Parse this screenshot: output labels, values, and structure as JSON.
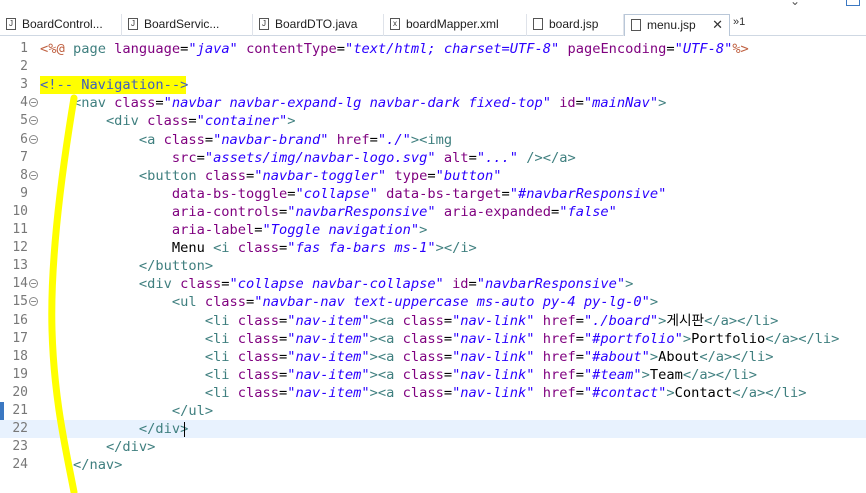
{
  "tabs": [
    {
      "label": "BoardControl...",
      "icon": "java-file-icon",
      "icon_char": "J",
      "active": false
    },
    {
      "label": "BoardServic...",
      "icon": "java-file-icon",
      "icon_char": "J",
      "active": false
    },
    {
      "label": "BoardDTO.java",
      "icon": "java-file-icon",
      "icon_char": "J",
      "active": false
    },
    {
      "label": "boardMapper.xml",
      "icon": "xml-file-icon",
      "icon_char": "x",
      "active": false
    },
    {
      "label": "board.jsp",
      "icon": "jsp-file-icon",
      "icon_char": "",
      "active": false
    },
    {
      "label": "menu.jsp",
      "icon": "jsp-file-icon",
      "icon_char": "",
      "active": true
    }
  ],
  "tab_close": "✕",
  "tab_overflow": "»1",
  "cursor_line": 22,
  "highlight_color": "#ffff00",
  "lines": [
    {
      "n": "1",
      "fold": false,
      "parts": [
        [
          "dir",
          "<%@ "
        ],
        [
          "kw",
          "page "
        ],
        [
          "attr",
          "language"
        ],
        [
          "",
          "="
        ],
        [
          "val",
          "\"java\""
        ],
        [
          "",
          " "
        ],
        [
          "attr",
          "contentType"
        ],
        [
          "",
          "="
        ],
        [
          "val",
          "\"text/html; charset=UTF-8\""
        ],
        [
          "",
          " "
        ],
        [
          "attr",
          "pageEncoding"
        ],
        [
          "",
          "="
        ],
        [
          "val",
          "\"UTF-8\""
        ],
        [
          "dir",
          "%>"
        ]
      ]
    },
    {
      "n": "2",
      "fold": false,
      "parts": []
    },
    {
      "n": "3",
      "fold": false,
      "parts": [
        [
          "cmt",
          "<!-- Navigation-->"
        ]
      ]
    },
    {
      "n": "4",
      "fold": true,
      "parts": [
        [
          "",
          "    "
        ],
        [
          "tag",
          "<nav "
        ],
        [
          "attr",
          "class"
        ],
        [
          "",
          "="
        ],
        [
          "val",
          "\"navbar navbar-expand-lg navbar-dark fixed-top\""
        ],
        [
          "",
          " "
        ],
        [
          "attr",
          "id"
        ],
        [
          "",
          "="
        ],
        [
          "val",
          "\"mainNav\""
        ],
        [
          "tag",
          ">"
        ]
      ]
    },
    {
      "n": "5",
      "fold": true,
      "parts": [
        [
          "",
          "        "
        ],
        [
          "tag",
          "<div "
        ],
        [
          "attr",
          "class"
        ],
        [
          "",
          "="
        ],
        [
          "val",
          "\"container\""
        ],
        [
          "tag",
          ">"
        ]
      ]
    },
    {
      "n": "6",
      "fold": true,
      "parts": [
        [
          "",
          "            "
        ],
        [
          "tag",
          "<a "
        ],
        [
          "attr",
          "class"
        ],
        [
          "",
          "="
        ],
        [
          "val",
          "\"navbar-brand\""
        ],
        [
          "",
          " "
        ],
        [
          "attr",
          "href"
        ],
        [
          "",
          "="
        ],
        [
          "val",
          "\"./\""
        ],
        [
          "tag",
          "><img"
        ]
      ]
    },
    {
      "n": "7",
      "fold": false,
      "parts": [
        [
          "",
          "                "
        ],
        [
          "attr",
          "src"
        ],
        [
          "",
          "="
        ],
        [
          "val",
          "\"assets/img/navbar-logo.svg\""
        ],
        [
          "",
          " "
        ],
        [
          "attr",
          "alt"
        ],
        [
          "",
          "="
        ],
        [
          "val",
          "\"...\""
        ],
        [
          "",
          " "
        ],
        [
          "tag",
          "/></a>"
        ]
      ]
    },
    {
      "n": "8",
      "fold": true,
      "parts": [
        [
          "",
          "            "
        ],
        [
          "tag",
          "<button "
        ],
        [
          "attr",
          "class"
        ],
        [
          "",
          "="
        ],
        [
          "val",
          "\"navbar-toggler\""
        ],
        [
          "",
          " "
        ],
        [
          "attr",
          "type"
        ],
        [
          "",
          "="
        ],
        [
          "val",
          "\"button\""
        ]
      ]
    },
    {
      "n": "9",
      "fold": false,
      "parts": [
        [
          "",
          "                "
        ],
        [
          "attr",
          "data-bs-toggle"
        ],
        [
          "",
          "="
        ],
        [
          "val",
          "\"collapse\""
        ],
        [
          "",
          " "
        ],
        [
          "attr",
          "data-bs-target"
        ],
        [
          "",
          "="
        ],
        [
          "val",
          "\"#navbarResponsive\""
        ]
      ]
    },
    {
      "n": "10",
      "fold": false,
      "parts": [
        [
          "",
          "                "
        ],
        [
          "attr",
          "aria-controls"
        ],
        [
          "",
          "="
        ],
        [
          "val",
          "\"navbarResponsive\""
        ],
        [
          "",
          " "
        ],
        [
          "attr",
          "aria-expanded"
        ],
        [
          "",
          "="
        ],
        [
          "val",
          "\"false\""
        ]
      ]
    },
    {
      "n": "11",
      "fold": false,
      "parts": [
        [
          "",
          "                "
        ],
        [
          "attr",
          "aria-label"
        ],
        [
          "",
          "="
        ],
        [
          "val",
          "\"Toggle navigation\""
        ],
        [
          "tag",
          ">"
        ]
      ]
    },
    {
      "n": "12",
      "fold": false,
      "parts": [
        [
          "",
          "                Menu "
        ],
        [
          "tag",
          "<i "
        ],
        [
          "attr",
          "class"
        ],
        [
          "",
          "="
        ],
        [
          "val",
          "\"fas fa-bars ms-1\""
        ],
        [
          "tag",
          "></i>"
        ]
      ]
    },
    {
      "n": "13",
      "fold": false,
      "parts": [
        [
          "",
          "            "
        ],
        [
          "tag",
          "</button>"
        ]
      ]
    },
    {
      "n": "14",
      "fold": true,
      "parts": [
        [
          "",
          "            "
        ],
        [
          "tag",
          "<div "
        ],
        [
          "attr",
          "class"
        ],
        [
          "",
          "="
        ],
        [
          "val",
          "\"collapse navbar-collapse\""
        ],
        [
          "",
          " "
        ],
        [
          "attr",
          "id"
        ],
        [
          "",
          "="
        ],
        [
          "val",
          "\"navbarResponsive\""
        ],
        [
          "tag",
          ">"
        ]
      ]
    },
    {
      "n": "15",
      "fold": true,
      "parts": [
        [
          "",
          "                "
        ],
        [
          "tag",
          "<ul "
        ],
        [
          "attr",
          "class"
        ],
        [
          "",
          "="
        ],
        [
          "val",
          "\"navbar-nav text-uppercase ms-auto py-4 py-lg-0\""
        ],
        [
          "tag",
          ">"
        ]
      ]
    },
    {
      "n": "16",
      "fold": false,
      "parts": [
        [
          "",
          "                    "
        ],
        [
          "tag",
          "<li "
        ],
        [
          "attr",
          "class"
        ],
        [
          "",
          "="
        ],
        [
          "val",
          "\"nav-item\""
        ],
        [
          "tag",
          "><a "
        ],
        [
          "attr",
          "class"
        ],
        [
          "",
          "="
        ],
        [
          "val",
          "\"nav-link\""
        ],
        [
          "",
          " "
        ],
        [
          "attr",
          "href"
        ],
        [
          "",
          "="
        ],
        [
          "val",
          "\"./board\""
        ],
        [
          "tag",
          ">"
        ],
        [
          "",
          "게시판"
        ],
        [
          "tag",
          "</a></li>"
        ]
      ]
    },
    {
      "n": "17",
      "fold": false,
      "parts": [
        [
          "",
          "                    "
        ],
        [
          "tag",
          "<li "
        ],
        [
          "attr",
          "class"
        ],
        [
          "",
          "="
        ],
        [
          "val",
          "\"nav-item\""
        ],
        [
          "tag",
          "><a "
        ],
        [
          "attr",
          "class"
        ],
        [
          "",
          "="
        ],
        [
          "val",
          "\"nav-link\""
        ],
        [
          "",
          " "
        ],
        [
          "attr",
          "href"
        ],
        [
          "",
          "="
        ],
        [
          "val",
          "\"#portfolio\""
        ],
        [
          "tag",
          ">"
        ],
        [
          "",
          "Portfolio"
        ],
        [
          "tag",
          "</a></li>"
        ]
      ]
    },
    {
      "n": "18",
      "fold": false,
      "parts": [
        [
          "",
          "                    "
        ],
        [
          "tag",
          "<li "
        ],
        [
          "attr",
          "class"
        ],
        [
          "",
          "="
        ],
        [
          "val",
          "\"nav-item\""
        ],
        [
          "tag",
          "><a "
        ],
        [
          "attr",
          "class"
        ],
        [
          "",
          "="
        ],
        [
          "val",
          "\"nav-link\""
        ],
        [
          "",
          " "
        ],
        [
          "attr",
          "href"
        ],
        [
          "",
          "="
        ],
        [
          "val",
          "\"#about\""
        ],
        [
          "tag",
          ">"
        ],
        [
          "",
          "About"
        ],
        [
          "tag",
          "</a></li>"
        ]
      ]
    },
    {
      "n": "19",
      "fold": false,
      "parts": [
        [
          "",
          "                    "
        ],
        [
          "tag",
          "<li "
        ],
        [
          "attr",
          "class"
        ],
        [
          "",
          "="
        ],
        [
          "val",
          "\"nav-item\""
        ],
        [
          "tag",
          "><a "
        ],
        [
          "attr",
          "class"
        ],
        [
          "",
          "="
        ],
        [
          "val",
          "\"nav-link\""
        ],
        [
          "",
          " "
        ],
        [
          "attr",
          "href"
        ],
        [
          "",
          "="
        ],
        [
          "val",
          "\"#team\""
        ],
        [
          "tag",
          ">"
        ],
        [
          "",
          "Team"
        ],
        [
          "tag",
          "</a></li>"
        ]
      ]
    },
    {
      "n": "20",
      "fold": false,
      "parts": [
        [
          "",
          "                    "
        ],
        [
          "tag",
          "<li "
        ],
        [
          "attr",
          "class"
        ],
        [
          "",
          "="
        ],
        [
          "val",
          "\"nav-item\""
        ],
        [
          "tag",
          "><a "
        ],
        [
          "attr",
          "class"
        ],
        [
          "",
          "="
        ],
        [
          "val",
          "\"nav-link\""
        ],
        [
          "",
          " "
        ],
        [
          "attr",
          "href"
        ],
        [
          "",
          "="
        ],
        [
          "val",
          "\"#contact\""
        ],
        [
          "tag",
          ">"
        ],
        [
          "",
          "Contact"
        ],
        [
          "tag",
          "</a></li>"
        ]
      ]
    },
    {
      "n": "21",
      "fold": false,
      "parts": [
        [
          "",
          "                "
        ],
        [
          "tag",
          "</ul>"
        ]
      ]
    },
    {
      "n": "22",
      "fold": false,
      "parts": [
        [
          "",
          "            "
        ],
        [
          "tag",
          "</div>"
        ]
      ]
    },
    {
      "n": "23",
      "fold": false,
      "parts": [
        [
          "",
          "        "
        ],
        [
          "tag",
          "</div>"
        ]
      ]
    },
    {
      "n": "24",
      "fold": false,
      "parts": [
        [
          "",
          "    "
        ],
        [
          "tag",
          "</nav>"
        ]
      ]
    }
  ]
}
